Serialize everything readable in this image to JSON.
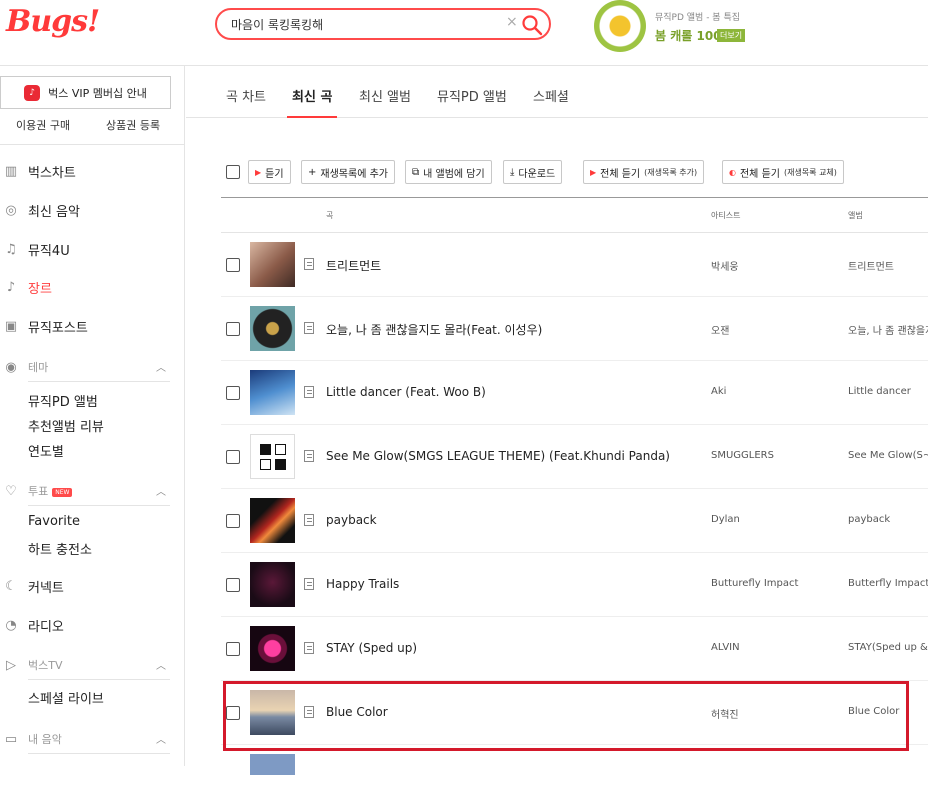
{
  "brand": {
    "logo_text": "Bugs!"
  },
  "search": {
    "value": "마음이 록킹록킹해",
    "clear_glyph": "×"
  },
  "promo": {
    "line1": "뮤직PD 앨범 - 봄 특집",
    "line2": "봄 캐롤 100",
    "more_label": "더보기"
  },
  "sidebar": {
    "vip_label": "벅스 VIP 멤버십 안내",
    "buy_pass": "이용권 구매",
    "register_gift": "상품권 등록",
    "items": [
      {
        "label": "벅스차트",
        "icon": "chart-icon"
      },
      {
        "label": "최신 음악",
        "icon": "new-music-icon"
      },
      {
        "label": "뮤직4U",
        "icon": "music-note-icon"
      },
      {
        "label": "장르",
        "icon": "guitar-icon"
      },
      {
        "label": "뮤직포스트",
        "icon": "post-icon"
      }
    ],
    "theme": {
      "label": "테마",
      "subs": [
        "뮤직PD 앨범",
        "추천앨범 리뷰",
        "연도별"
      ]
    },
    "vote": {
      "label": "투표",
      "badge": "NEW",
      "subs": [
        "Favorite",
        "하트 충전소"
      ]
    },
    "connect": "커넥트",
    "radio": "라디오",
    "bugstv": {
      "label": "벅스TV",
      "subs": [
        "스페셜 라이브"
      ]
    },
    "mymusic": {
      "label": "내 음악"
    }
  },
  "tabs": [
    "곡 차트",
    "최신 곡",
    "최신 앨범",
    "뮤직PD 앨범",
    "스페셜"
  ],
  "active_tab": "최신 곡",
  "toolbar": {
    "listen": "듣기",
    "add_playlist": "재생목록에 추가",
    "add_album": "내 앨범에 담기",
    "download": "다운로드",
    "listen_all_add": "전체 듣기",
    "listen_all_add_sub": "(재생목록 추가)",
    "listen_all_replace": "전체 듣기",
    "listen_all_replace_sub": "(재생목록 교체)"
  },
  "columns": {
    "song": "곡",
    "artist": "아티스트",
    "album": "앨범"
  },
  "rows": [
    {
      "title": "트리트먼트",
      "artist": "박세웅",
      "album": "트리트먼트"
    },
    {
      "title": "오늘, 나 좀 괜찮을지도 몰라(Feat. 이성우)",
      "artist": "오잰",
      "album": "오늘, 나 좀 괜찮을지"
    },
    {
      "title": "Little dancer (Feat. Woo B)",
      "artist": "Aki",
      "album": "Little dancer"
    },
    {
      "title": "See Me Glow(SMGS LEAGUE THEME) (Feat.Khundi Panda)",
      "artist": "SMUGGLERS",
      "album": "See Me Glow(S~"
    },
    {
      "title": "payback",
      "artist": "Dylan",
      "album": "payback"
    },
    {
      "title": "Happy Trails",
      "artist": "Butturefly Impact",
      "album": "Butterfly Impact"
    },
    {
      "title": "STAY (Sped up)",
      "artist": "ALVIN",
      "album": "STAY(Sped up &"
    },
    {
      "title": "Blue Color",
      "artist": "허혁진",
      "album": "Blue Color"
    }
  ],
  "colors": {
    "brand_red": "#ff3a3a",
    "highlight_box": "#d4192b"
  }
}
